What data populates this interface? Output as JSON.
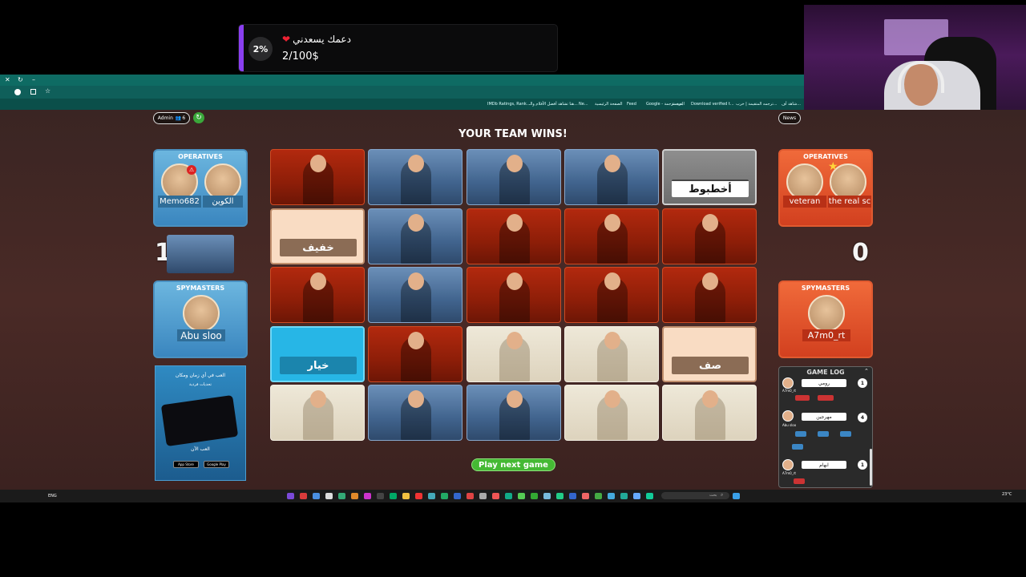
{
  "donation": {
    "percent": "2%",
    "message": "دعمك يسعدني",
    "amount": "2/100$"
  },
  "top_bar": {
    "admin_label": "Admin",
    "players_count": "6",
    "news_label": "News"
  },
  "status_title": "YOUR TEAM WINS!",
  "blue_team": {
    "score": "1",
    "operatives_label": "OPERATIVES",
    "operatives": [
      "Memo682",
      "الكوين"
    ],
    "spymasters_label": "SPYMASTERS",
    "spymasters": [
      "Abu sloo"
    ]
  },
  "red_team": {
    "score": "0",
    "operatives_label": "OPERATIVES",
    "operatives": [
      "veteran",
      "the real sc"
    ],
    "spymasters_label": "SPYMASTERS",
    "spymasters": [
      "A7m0_rt"
    ]
  },
  "cards": [
    {
      "type": "red",
      "word": ""
    },
    {
      "type": "blue",
      "word": ""
    },
    {
      "type": "blue",
      "word": ""
    },
    {
      "type": "blue",
      "word": ""
    },
    {
      "type": "assassin",
      "word": "أخطبوط"
    },
    {
      "type": "neutral-word",
      "word": "خفيف"
    },
    {
      "type": "blue",
      "word": ""
    },
    {
      "type": "red",
      "word": ""
    },
    {
      "type": "red",
      "word": ""
    },
    {
      "type": "red",
      "word": ""
    },
    {
      "type": "red",
      "word": ""
    },
    {
      "type": "blue",
      "word": ""
    },
    {
      "type": "red",
      "word": ""
    },
    {
      "type": "red",
      "word": ""
    },
    {
      "type": "red",
      "word": ""
    },
    {
      "type": "blue-word",
      "word": "خيار"
    },
    {
      "type": "red",
      "word": ""
    },
    {
      "type": "bystander",
      "word": ""
    },
    {
      "type": "bystander",
      "word": ""
    },
    {
      "type": "neutral-word",
      "word": "صف"
    },
    {
      "type": "bystander",
      "word": ""
    },
    {
      "type": "blue",
      "word": ""
    },
    {
      "type": "blue",
      "word": ""
    },
    {
      "type": "bystander",
      "word": ""
    },
    {
      "type": "bystander",
      "word": ""
    }
  ],
  "play_next": "Play next game",
  "ad": {
    "line1": "العب في أي زمان ومكان",
    "line2": "تحديات فردية",
    "line3": "العب الآن",
    "store1": "App Store",
    "store2": "Google Play"
  },
  "game_log": {
    "title": "GAME LOG",
    "entries": [
      {
        "player": "A7m0_rt",
        "clue": "رومي",
        "number": "1"
      },
      {
        "player": "Abu sloo",
        "clue": "مهرجين",
        "number": "4"
      },
      {
        "player": "A7m0_rt",
        "clue": "ابهام",
        "number": "1"
      }
    ]
  },
  "bookmarks": [
    "IMDb Ratings, Rank...",
    "هنا تشاهد أفضل الأفلام والـ...",
    "Ne...",
    "الصفحة الرئيسية",
    "Feed",
    "Google - بحث ترجمة",
    "الترجمة",
    "Download verified t...",
    "ترجمه المتقيمة | خرب...",
    "شاهد أف..."
  ],
  "taskbar": {
    "lang": "ENG",
    "search": "بحث",
    "weather": "23°C"
  }
}
